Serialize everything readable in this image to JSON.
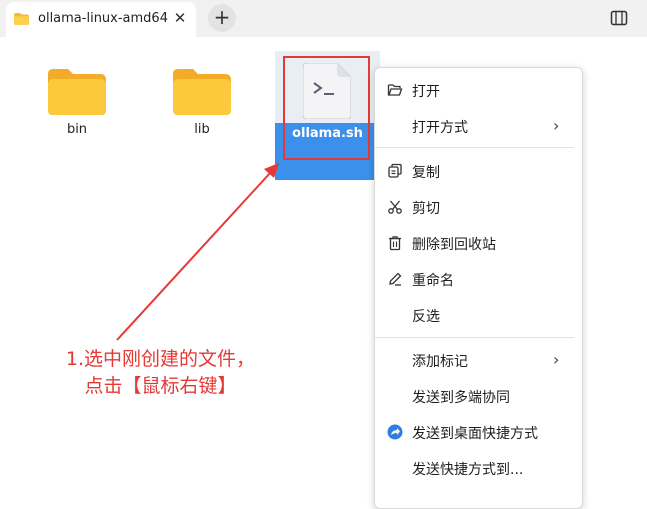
{
  "tab": {
    "title": "ollama-linux-amd64",
    "close_glyph": "✕",
    "icon": "folder-icon"
  },
  "toolbar": {
    "new_tab_glyph": "+",
    "view_icon": "sidebar-view-icon"
  },
  "files": [
    {
      "name": "bin",
      "icon": "folder-icon"
    },
    {
      "name": "lib",
      "icon": "folder-icon"
    },
    {
      "name": "ollama.sh",
      "icon": "terminal-script-icon",
      "selected": true
    }
  ],
  "context_menu": {
    "items": [
      {
        "label": "打开",
        "icon": "open-folder-icon"
      },
      {
        "label": "打开方式",
        "submenu": true
      },
      {
        "label": "复制",
        "icon": "copy-icon"
      },
      {
        "label": "剪切",
        "icon": "scissors-icon"
      },
      {
        "label": "删除到回收站",
        "icon": "trash-icon"
      },
      {
        "label": "重命名",
        "icon": "rename-icon"
      },
      {
        "label": "反选"
      },
      {
        "label": "添加标记",
        "submenu": true
      },
      {
        "label": "发送到多端协同"
      },
      {
        "label": "发送到桌面快捷方式",
        "icon": "send-desktop-icon"
      },
      {
        "label": "发送快捷方式到..."
      }
    ],
    "submenu_glyph": "›"
  },
  "annotation": {
    "line1": "1.选中刚创建的文件，",
    "line2": "点击【鼠标右键】",
    "color": "#e53935"
  },
  "colors": {
    "selection": "#3a90ea",
    "folder": "#f6c23e",
    "accent_red": "#e53935"
  }
}
